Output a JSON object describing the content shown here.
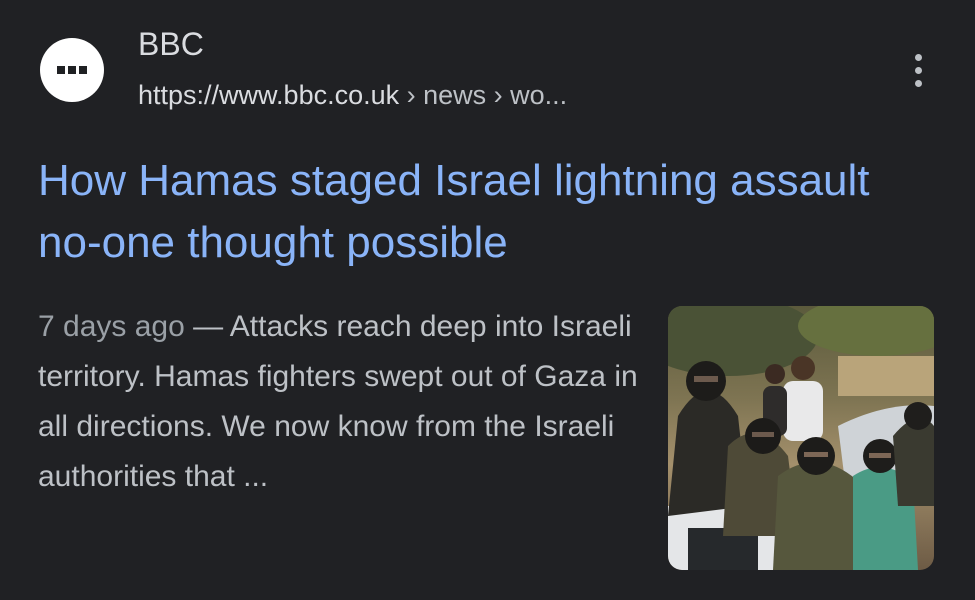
{
  "result": {
    "site_name": "BBC",
    "url": "https://www.bbc.co.uk",
    "path": " › news › wo...",
    "title": "How Hamas staged Israel lightning assault no-one thought possible",
    "date": "7 days ago",
    "separator": " — ",
    "snippet": "Attacks reach deep into Israeli territory. Hamas fighters swept out of Gaza in all directions. We now know from the Israeli authorities that ...",
    "favicon": "bbc-favicon-icon",
    "menu_icon": "more-vert-icon",
    "thumbnail": "news-thumbnail-photo"
  },
  "colors": {
    "background": "#202124",
    "link": "#8ab4f8",
    "text": "#bdc1c6"
  }
}
